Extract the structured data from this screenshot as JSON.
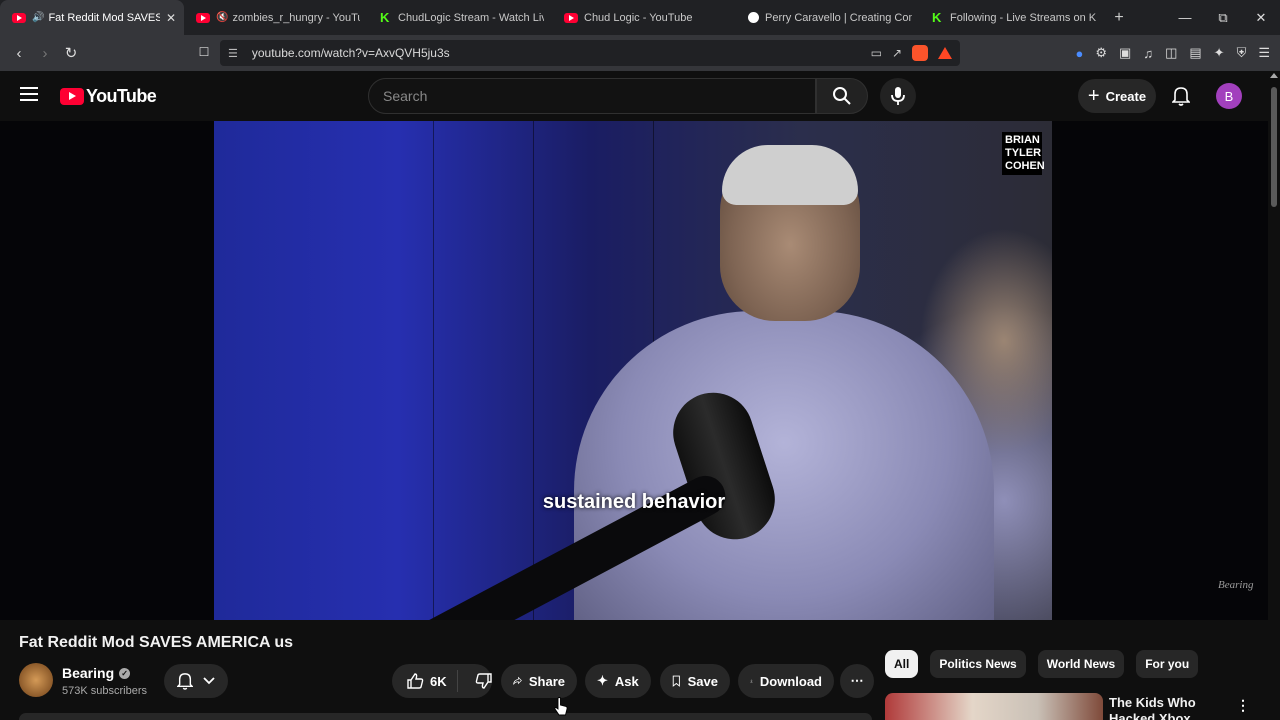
{
  "browser": {
    "tabs": [
      {
        "title": "Fat Reddit Mod SAVES AMERICA us",
        "favicon": "youtube-favicon",
        "audio": "speaker-icon",
        "active": true
      },
      {
        "title": "zombies_r_hungry - YouTube",
        "favicon": "youtube-favicon",
        "audio": "muted-speaker-icon",
        "active": false
      },
      {
        "title": "ChudLogic Stream - Watch Live",
        "favicon": "kick-favicon",
        "active": false
      },
      {
        "title": "Chud Logic - YouTube",
        "favicon": "youtube-favicon",
        "active": false
      },
      {
        "title": "Perry Caravello | Creating Come",
        "favicon": "patreon-favicon",
        "active": false
      },
      {
        "title": "Following - Live Streams on Kick",
        "favicon": "kick-favicon",
        "active": false
      }
    ],
    "url": "youtube.com/watch?v=AxvQVH5ju3s",
    "new_tab": "+",
    "window_controls": [
      "minimize",
      "restore",
      "close"
    ]
  },
  "youtube": {
    "logo_text": "YouTube",
    "search_placeholder": "Search",
    "create_label": "Create",
    "avatar_letter": "B",
    "accent_color": "#ff0033"
  },
  "player": {
    "watermark": "BRIAN TYLER COHEN",
    "caption": "sustained behavior",
    "channel_mark": "Bearing"
  },
  "video": {
    "title": "Fat Reddit Mod SAVES AMERICA us",
    "channel": "Bearing",
    "subscribers": "573K subscribers",
    "likes": "6K",
    "share_label": "Share",
    "ask_label": "Ask",
    "save_label": "Save",
    "download_label": "Download"
  },
  "sidebar": {
    "chips": [
      {
        "label": "All",
        "active": true
      },
      {
        "label": "Politics News",
        "active": false
      },
      {
        "label": "World News",
        "active": false
      },
      {
        "label": "For you",
        "active": false
      }
    ],
    "recommendation": {
      "title": "The Kids Who Hacked Xbox"
    }
  }
}
